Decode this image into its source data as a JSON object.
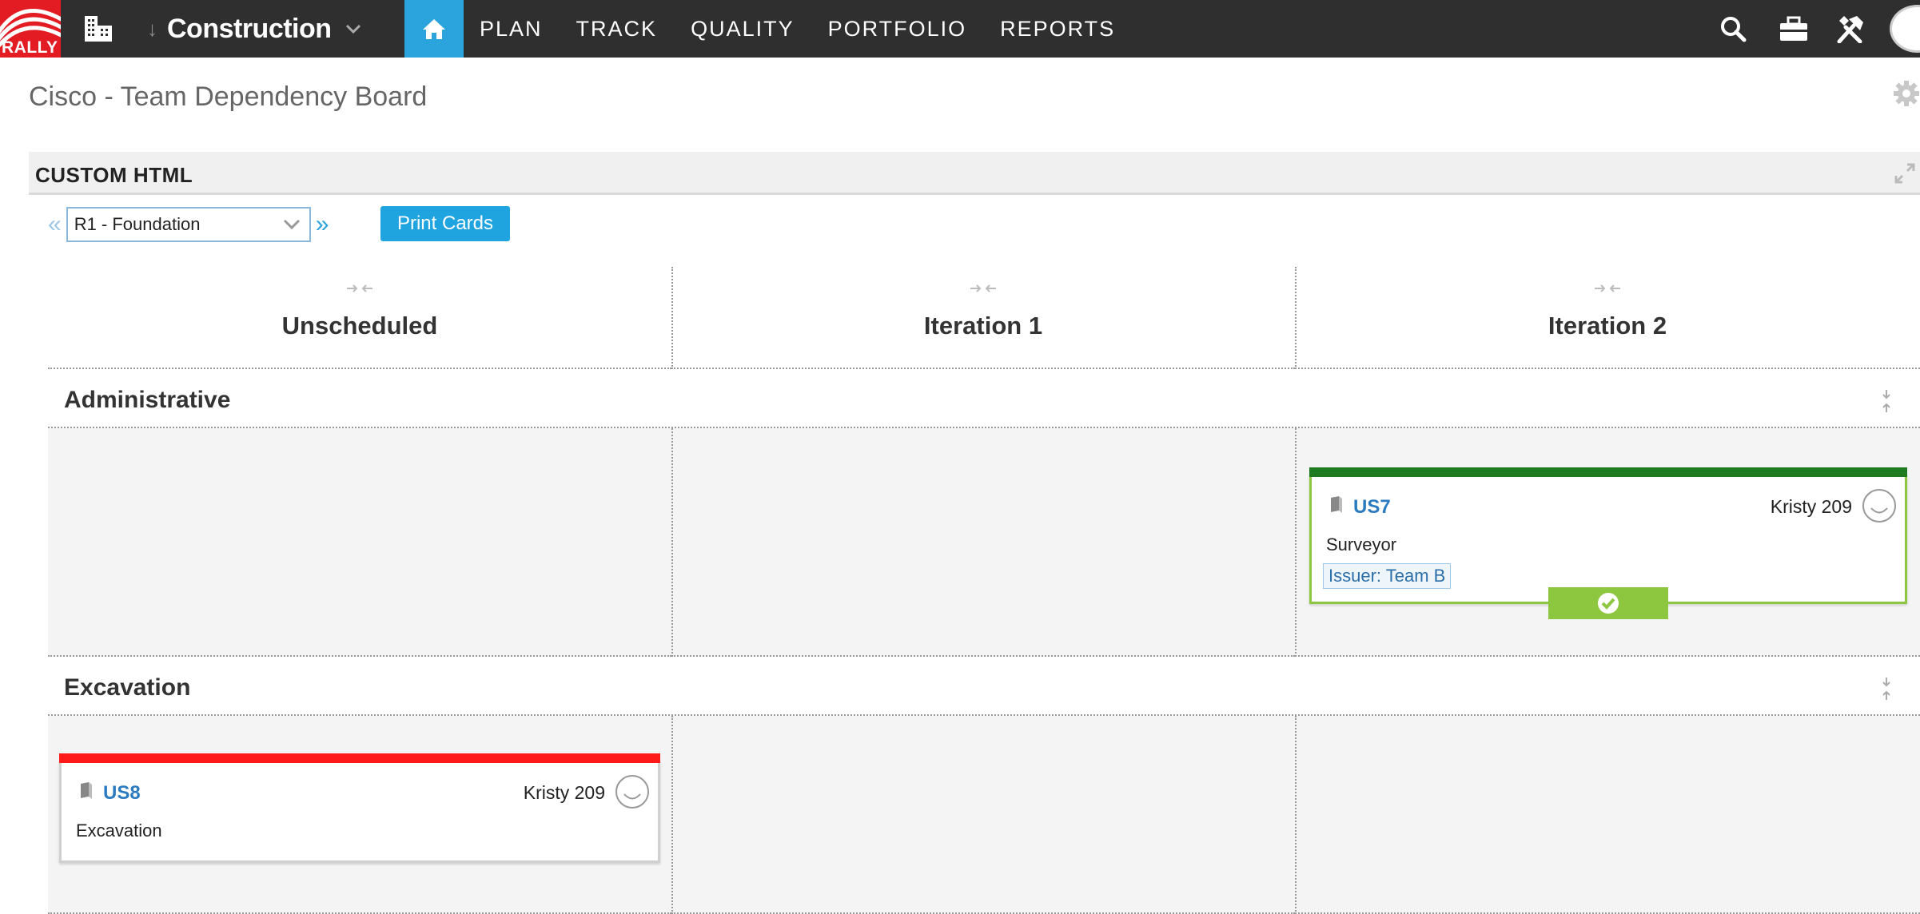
{
  "topnav": {
    "logo_text": "RALLY",
    "project_name": "Construction",
    "nav_links": [
      "PLAN",
      "TRACK",
      "QUALITY",
      "PORTFOLIO",
      "REPORTS"
    ],
    "colors": {
      "bar": "#2f2f2f",
      "home_active": "#2ba4de",
      "logo": "#e31b23"
    }
  },
  "page": {
    "title": "Cisco - Team Dependency Board"
  },
  "panel": {
    "title": "CUSTOM HTML",
    "release_select": {
      "value": "R1 - Foundation"
    },
    "prev_label": "«",
    "next_label": "»",
    "print_button": "Print Cards"
  },
  "board": {
    "columns": [
      "Unscheduled",
      "Iteration 1",
      "Iteration 2"
    ],
    "swimlanes": [
      {
        "title": "Administrative",
        "cards": [
          {
            "column": "Iteration 2",
            "id": "US7",
            "owner": "Kristy 209",
            "name": "Surveyor",
            "tag": "Issuer: Team B",
            "status_color": "#1e7a1e",
            "ready": true
          }
        ]
      },
      {
        "title": "Excavation",
        "cards": [
          {
            "column": "Unscheduled",
            "id": "US8",
            "owner": "Kristy 209",
            "name": "Excavation",
            "status_color": "#ff1a1a",
            "ready": false
          }
        ]
      }
    ]
  }
}
